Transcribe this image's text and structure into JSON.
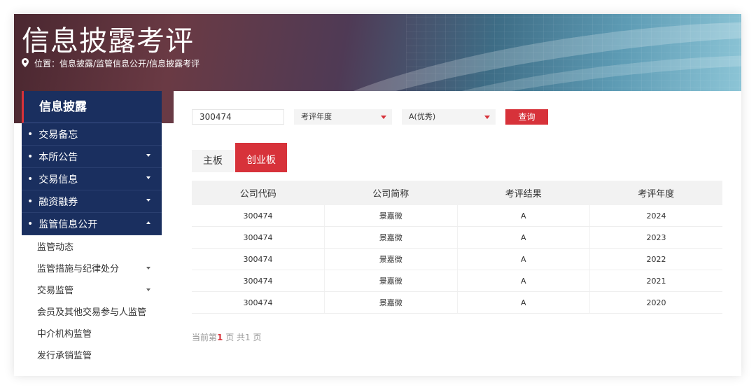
{
  "header": {
    "title": "信息披露考评",
    "breadcrumb": "位置：信息披露/监管信息公开/信息披露考评"
  },
  "sidebar": {
    "heading": "信息披露",
    "items": [
      {
        "label": "交易备忘"
      },
      {
        "label": "本所公告"
      },
      {
        "label": "交易信息"
      },
      {
        "label": "融资融券"
      },
      {
        "label": "监管信息公开"
      }
    ],
    "subitems": [
      {
        "label": "监管动态"
      },
      {
        "label": "监管措施与纪律处分"
      },
      {
        "label": "交易监管"
      },
      {
        "label": "会员及其他交易参与人监管"
      },
      {
        "label": "中介机构监管"
      },
      {
        "label": "发行承销监管"
      }
    ]
  },
  "filter": {
    "code_value": "300474",
    "year_select": "考评年度",
    "result_select": "A(优秀)",
    "query_button": "查询"
  },
  "tabs": [
    "主板",
    "创业板"
  ],
  "table": {
    "headers": [
      "公司代码",
      "公司简称",
      "考评结果",
      "考评年度"
    ],
    "rows": [
      [
        "300474",
        "景嘉微",
        "A",
        "2024"
      ],
      [
        "300474",
        "景嘉微",
        "A",
        "2023"
      ],
      [
        "300474",
        "景嘉微",
        "A",
        "2022"
      ],
      [
        "300474",
        "景嘉微",
        "A",
        "2021"
      ],
      [
        "300474",
        "景嘉微",
        "A",
        "2020"
      ]
    ]
  },
  "pager": {
    "prefix": "当前第",
    "current": "1",
    "mid": " 页  共",
    "total": "1",
    "suffix": " 页"
  },
  "colors": {
    "accent": "#d7323a",
    "sidebar": "#1a2f5f"
  }
}
